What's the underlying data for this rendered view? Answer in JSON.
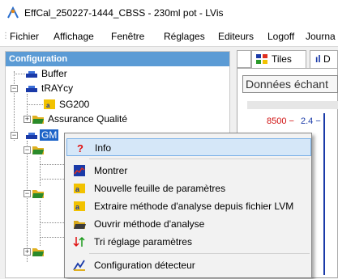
{
  "window": {
    "title": "EffCal_250227-1444_CBSS - 230ml pot - LVis",
    "app_icon": "lvis-logo-icon"
  },
  "menubar": {
    "items": [
      "Fichier",
      "Affichage",
      "Fenêtre",
      "Réglages",
      "Editeurs",
      "Logoff",
      "Journa"
    ]
  },
  "config_panel": {
    "header": "Configuration",
    "tree": {
      "buffer": "Buffer",
      "traycy": "tRAYcy",
      "sg200": "SG200",
      "assurance": "Assurance Qualité",
      "gm": "GM"
    }
  },
  "right_pane": {
    "tabs": [
      "Tiles",
      "D"
    ],
    "donnees_label": "Données échant",
    "value_red": "8500",
    "value_blue": "2.4"
  },
  "context_menu": {
    "items": [
      {
        "label": "Info",
        "icon": "question-mark-icon",
        "highlighted": true
      },
      {
        "label": "Montrer",
        "icon": "chart-icon"
      },
      {
        "label": "Nouvelle feuille de paramètres",
        "icon": "yellow-folder-sheet-icon"
      },
      {
        "label": "Extraire méthode d'analyse depuis fichier LVM",
        "icon": "yellow-folder-extract-icon"
      },
      {
        "label": "Ouvrir méthode d'analyse",
        "icon": "open-folder-icon"
      },
      {
        "label": "Tri réglage paramètres",
        "icon": "sort-arrows-icon"
      },
      {
        "label": "Configuration détecteur",
        "icon": "detector-config-icon"
      }
    ]
  },
  "colors": {
    "panel_header": "#5b9bd5",
    "selection": "#1e64c8",
    "menu_highlight": "#d5e7f8"
  }
}
